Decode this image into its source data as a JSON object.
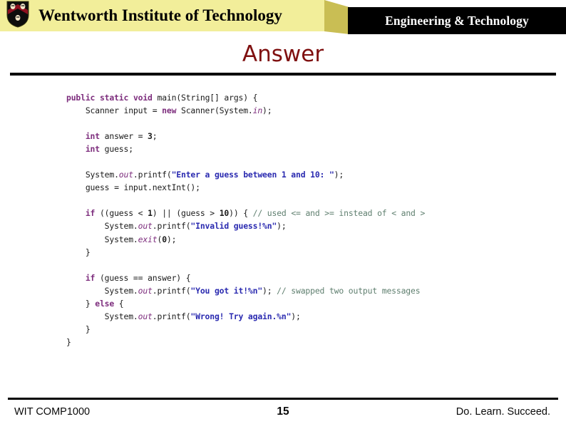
{
  "header": {
    "institution": "Wentworth Institute of Technology",
    "department": "Engineering & Technology",
    "logo_icon": "wit-shield-crest-icon",
    "colors": {
      "bar": "#F2EE9A",
      "wedge": "#C9BE54",
      "banner": "#000000",
      "banner_text": "#FFFFFF"
    }
  },
  "slide": {
    "title": "Answer",
    "title_color": "#7F1010"
  },
  "code": {
    "language": "java",
    "colors": {
      "keyword": "#7D2D7D",
      "string": "#2A2AB0",
      "comment": "#5F7F6F",
      "identifier": "#1A1A1A"
    },
    "lines": [
      [
        {
          "t": "public",
          "c": "kw"
        },
        {
          "t": " ",
          "c": "pl"
        },
        {
          "t": "static",
          "c": "kw"
        },
        {
          "t": " ",
          "c": "pl"
        },
        {
          "t": "void",
          "c": "kw"
        },
        {
          "t": " ",
          "c": "pl"
        },
        {
          "t": "main(String[] args) {",
          "c": "id"
        }
      ],
      [
        {
          "t": "    Scanner input = ",
          "c": "id"
        },
        {
          "t": "new",
          "c": "kw"
        },
        {
          "t": " Scanner(System.",
          "c": "id"
        },
        {
          "t": "in",
          "c": "fld"
        },
        {
          "t": ");",
          "c": "id"
        }
      ],
      [],
      [
        {
          "t": "    ",
          "c": "pl"
        },
        {
          "t": "int",
          "c": "kw"
        },
        {
          "t": " answer = ",
          "c": "id"
        },
        {
          "t": "3",
          "c": "num"
        },
        {
          "t": ";",
          "c": "id"
        }
      ],
      [
        {
          "t": "    ",
          "c": "pl"
        },
        {
          "t": "int",
          "c": "kw"
        },
        {
          "t": " guess;",
          "c": "id"
        }
      ],
      [],
      [
        {
          "t": "    System.",
          "c": "id"
        },
        {
          "t": "out",
          "c": "fld"
        },
        {
          "t": ".printf(",
          "c": "id"
        },
        {
          "t": "\"Enter a guess between 1 and 10: \"",
          "c": "str"
        },
        {
          "t": ");",
          "c": "id"
        }
      ],
      [
        {
          "t": "    guess = input.nextInt();",
          "c": "id"
        }
      ],
      [],
      [
        {
          "t": "    ",
          "c": "pl"
        },
        {
          "t": "if",
          "c": "kw"
        },
        {
          "t": " ((guess < ",
          "c": "id"
        },
        {
          "t": "1",
          "c": "num"
        },
        {
          "t": ") || (guess > ",
          "c": "id"
        },
        {
          "t": "10",
          "c": "num"
        },
        {
          "t": ")) { ",
          "c": "id"
        },
        {
          "t": "// used <= and >= instead of < and >",
          "c": "cmt"
        }
      ],
      [
        {
          "t": "        System.",
          "c": "id"
        },
        {
          "t": "out",
          "c": "fld"
        },
        {
          "t": ".printf(",
          "c": "id"
        },
        {
          "t": "\"Invalid guess!%n\"",
          "c": "str"
        },
        {
          "t": ");",
          "c": "id"
        }
      ],
      [
        {
          "t": "        System.",
          "c": "id"
        },
        {
          "t": "exit",
          "c": "fld"
        },
        {
          "t": "(",
          "c": "id"
        },
        {
          "t": "0",
          "c": "num"
        },
        {
          "t": ");",
          "c": "id"
        }
      ],
      [
        {
          "t": "    }",
          "c": "id"
        }
      ],
      [],
      [
        {
          "t": "    ",
          "c": "pl"
        },
        {
          "t": "if",
          "c": "kw"
        },
        {
          "t": " (guess == answer) {",
          "c": "id"
        }
      ],
      [
        {
          "t": "        System.",
          "c": "id"
        },
        {
          "t": "out",
          "c": "fld"
        },
        {
          "t": ".printf(",
          "c": "id"
        },
        {
          "t": "\"You got it!%n\"",
          "c": "str"
        },
        {
          "t": "); ",
          "c": "id"
        },
        {
          "t": "// swapped two output messages",
          "c": "cmt"
        }
      ],
      [
        {
          "t": "    } ",
          "c": "id"
        },
        {
          "t": "else",
          "c": "kw"
        },
        {
          "t": " {",
          "c": "id"
        }
      ],
      [
        {
          "t": "        System.",
          "c": "id"
        },
        {
          "t": "out",
          "c": "fld"
        },
        {
          "t": ".printf(",
          "c": "id"
        },
        {
          "t": "\"Wrong! Try again.%n\"",
          "c": "str"
        },
        {
          "t": ");",
          "c": "id"
        }
      ],
      [
        {
          "t": "    }",
          "c": "id"
        }
      ],
      [
        {
          "t": "}",
          "c": "id"
        }
      ]
    ]
  },
  "footer": {
    "left": "WIT COMP1000",
    "page_number": "15",
    "right": "Do. Learn. Succeed."
  }
}
